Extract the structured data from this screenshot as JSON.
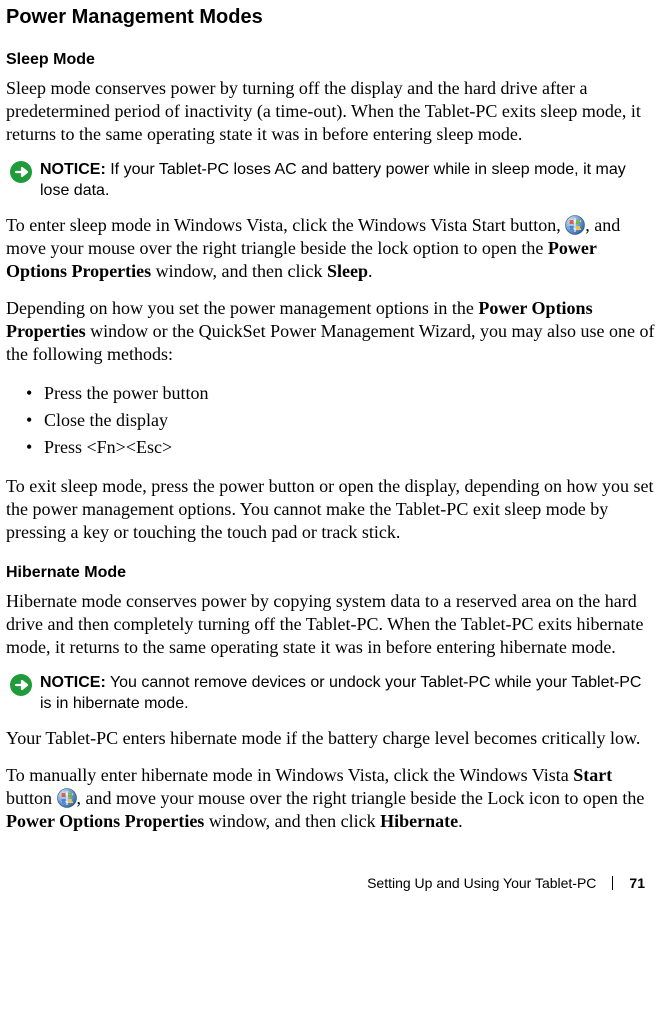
{
  "heading": "Power Management Modes",
  "sleep": {
    "title": "Sleep Mode",
    "p1": "Sleep mode conserves power by turning off the display and the hard drive after a predetermined period of inactivity (a time-out). When the Tablet-PC exits sleep mode, it returns to the same operating state it was in before entering sleep mode.",
    "notice_label": "NOTICE:",
    "notice_text": " If your Tablet-PC loses AC and battery power while in sleep mode, it may lose data.",
    "p2a": "To enter sleep mode in Windows Vista, click the Windows Vista Start button, ",
    "p2b": ", and move your mouse over the right triangle beside the lock option to open the ",
    "p2c": "Power Options Properties",
    "p2d": " window, and then click ",
    "p2e": "Sleep",
    "p2f": ".",
    "p3a": "Depending on how you set the power management options in the ",
    "p3b": "Power Options Properties",
    "p3c": " window or the QuickSet Power Management Wizard, you may also use one of the following methods:",
    "bullets": [
      "Press the power button",
      "Close the display",
      "Press <Fn><Esc>"
    ],
    "p4": "To exit sleep mode, press the power button or open the display, depending on how you set the power management options. You cannot make the Tablet-PC exit sleep mode by pressing a key or touching the touch pad or track stick."
  },
  "hibernate": {
    "title": "Hibernate Mode",
    "p1": "Hibernate mode conserves power by copying system data to a reserved area on the hard drive and then completely turning off the Tablet-PC. When the Tablet-PC exits hibernate mode, it returns to the same operating state it was in before entering hibernate mode.",
    "notice_label": "NOTICE:",
    "notice_text": " You cannot remove devices or undock your Tablet-PC while your Tablet-PC is in hibernate mode.",
    "p2": "Your Tablet-PC enters hibernate mode if the battery charge level becomes critically low.",
    "p3a": "To manually enter hibernate mode in Windows Vista, click the Windows Vista ",
    "p3b": "Start",
    "p3c": " button ",
    "p3d": ", and move your mouse over the right triangle beside the Lock icon to open the ",
    "p3e": "Power Options Properties",
    "p3f": " window, and then click ",
    "p3g": "Hibernate",
    "p3h": "."
  },
  "footer": {
    "section": "Setting Up and Using Your Tablet-PC",
    "page": "71"
  }
}
